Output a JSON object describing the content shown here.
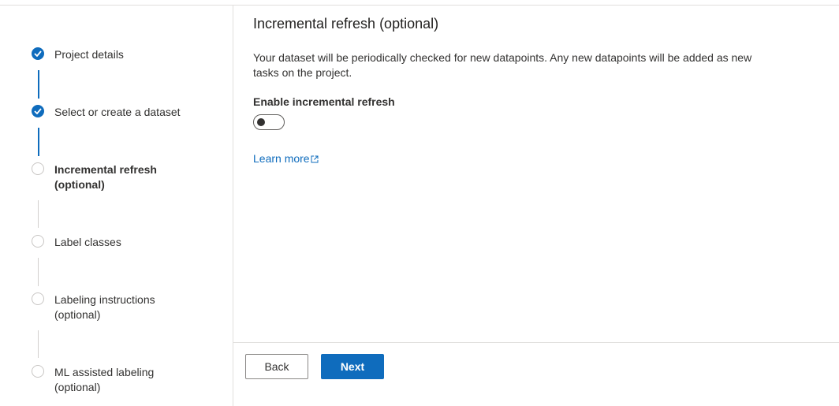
{
  "wizard": {
    "steps": [
      {
        "label": "Project details",
        "status": "completed"
      },
      {
        "label": "Select or create a dataset",
        "status": "completed"
      },
      {
        "label": "Incremental refresh (optional)",
        "status": "current"
      },
      {
        "label": "Label classes",
        "status": "pending"
      },
      {
        "label": "Labeling instructions (optional)",
        "status": "pending"
      },
      {
        "label": "ML assisted labeling (optional)",
        "status": "pending"
      }
    ]
  },
  "main": {
    "title": "Incremental refresh (optional)",
    "description": "Your dataset will be periodically checked for new datapoints. Any new datapoints will be added as new tasks on the project.",
    "toggle": {
      "label": "Enable incremental refresh",
      "on": false
    },
    "learn_more": "Learn more",
    "learn_more_icon": "external-link-icon"
  },
  "footer": {
    "back_label": "Back",
    "next_label": "Next"
  },
  "colors": {
    "accent": "#0f6cbd",
    "pending_circle": "#c8c6c4",
    "divider": "#e1dfdd"
  }
}
